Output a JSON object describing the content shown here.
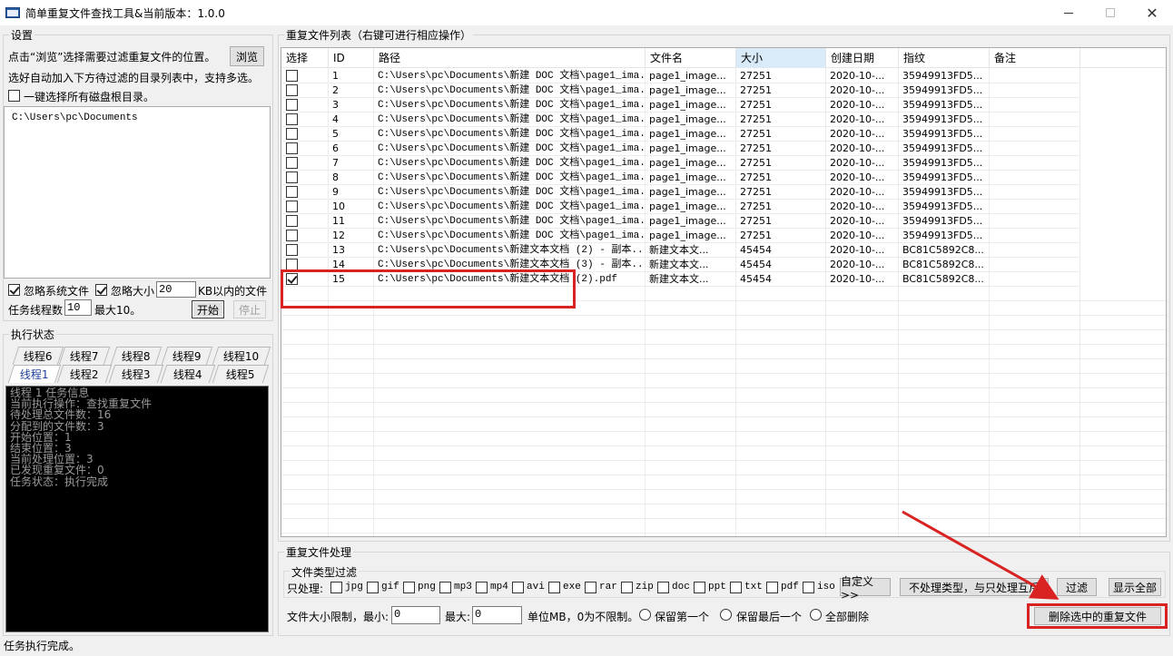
{
  "window": {
    "title": "简单重复文件查找工具&当前版本：1.0.0",
    "min_glyph": "—",
    "close_glyph": "✕"
  },
  "settings": {
    "group_label": "设置",
    "browse_hint": "点击“浏览”选择需要过滤重复文件的位置。",
    "browse_button": "浏览",
    "add_hint": "选好自动加入下方待过滤的目录列表中，支持多选。",
    "select_all_drives_label": "一键选择所有磁盘根目录。",
    "select_all_drives_checked": false,
    "directories": [
      "C:\\Users\\pc\\Documents"
    ],
    "ignore_system_label": "忽略系统文件",
    "ignore_system_checked": true,
    "ignore_size_label": "忽略大小",
    "ignore_size_checked": true,
    "ignore_size_value": "20",
    "ignore_size_unit": "KB以内的文件",
    "threads_label": "任务线程数",
    "threads_value": "10",
    "threads_max": "最大10。",
    "start_button": "开始",
    "stop_button": "停止"
  },
  "exec_status": {
    "group_label": "执行状态",
    "tabs_row1": [
      "线程6",
      "线程7",
      "线程8",
      "线程9",
      "线程10"
    ],
    "tabs_row2": [
      "线程1",
      "线程2",
      "线程3",
      "线程4",
      "线程5"
    ],
    "active_tab": "线程1",
    "console_lines": [
      "线程 1 任务信息",
      "当前执行操作：查找重复文件",
      "待处理总文件数：16",
      "分配到的文件数：3",
      "开始位置：1",
      "结束位置：3",
      "当前处理位置：3",
      "已发现重复文件：0",
      "任务状态：执行完成"
    ]
  },
  "file_list": {
    "group_label": "重复文件列表（右键可进行相应操作）",
    "columns": [
      "选择",
      "ID",
      "路径",
      "文件名",
      "大小",
      "创建日期",
      "指纹",
      "备注"
    ],
    "sorted_column": "大小",
    "rows": [
      {
        "checked": false,
        "id": "1",
        "path": "C:\\Users\\pc\\Documents\\新建 DOC 文档\\page1_ima...",
        "name": "page1_image...",
        "size": "27251",
        "date": "2020-10-...",
        "hash": "35949913FD5...",
        "note": ""
      },
      {
        "checked": false,
        "id": "2",
        "path": "C:\\Users\\pc\\Documents\\新建 DOC 文档\\page1_ima...",
        "name": "page1_image...",
        "size": "27251",
        "date": "2020-10-...",
        "hash": "35949913FD5...",
        "note": ""
      },
      {
        "checked": false,
        "id": "3",
        "path": "C:\\Users\\pc\\Documents\\新建 DOC 文档\\page1_ima...",
        "name": "page1_image...",
        "size": "27251",
        "date": "2020-10-...",
        "hash": "35949913FD5...",
        "note": ""
      },
      {
        "checked": false,
        "id": "4",
        "path": "C:\\Users\\pc\\Documents\\新建 DOC 文档\\page1_ima...",
        "name": "page1_image...",
        "size": "27251",
        "date": "2020-10-...",
        "hash": "35949913FD5...",
        "note": ""
      },
      {
        "checked": false,
        "id": "5",
        "path": "C:\\Users\\pc\\Documents\\新建 DOC 文档\\page1_ima...",
        "name": "page1_image...",
        "size": "27251",
        "date": "2020-10-...",
        "hash": "35949913FD5...",
        "note": ""
      },
      {
        "checked": false,
        "id": "6",
        "path": "C:\\Users\\pc\\Documents\\新建 DOC 文档\\page1_ima...",
        "name": "page1_image...",
        "size": "27251",
        "date": "2020-10-...",
        "hash": "35949913FD5...",
        "note": ""
      },
      {
        "checked": false,
        "id": "7",
        "path": "C:\\Users\\pc\\Documents\\新建 DOC 文档\\page1_ima...",
        "name": "page1_image...",
        "size": "27251",
        "date": "2020-10-...",
        "hash": "35949913FD5...",
        "note": ""
      },
      {
        "checked": false,
        "id": "8",
        "path": "C:\\Users\\pc\\Documents\\新建 DOC 文档\\page1_ima...",
        "name": "page1_image...",
        "size": "27251",
        "date": "2020-10-...",
        "hash": "35949913FD5...",
        "note": ""
      },
      {
        "checked": false,
        "id": "9",
        "path": "C:\\Users\\pc\\Documents\\新建 DOC 文档\\page1_ima...",
        "name": "page1_image...",
        "size": "27251",
        "date": "2020-10-...",
        "hash": "35949913FD5...",
        "note": ""
      },
      {
        "checked": false,
        "id": "10",
        "path": "C:\\Users\\pc\\Documents\\新建 DOC 文档\\page1_ima...",
        "name": "page1_image...",
        "size": "27251",
        "date": "2020-10-...",
        "hash": "35949913FD5...",
        "note": ""
      },
      {
        "checked": false,
        "id": "11",
        "path": "C:\\Users\\pc\\Documents\\新建 DOC 文档\\page1_ima...",
        "name": "page1_image...",
        "size": "27251",
        "date": "2020-10-...",
        "hash": "35949913FD5...",
        "note": ""
      },
      {
        "checked": false,
        "id": "12",
        "path": "C:\\Users\\pc\\Documents\\新建 DOC 文档\\page1_ima...",
        "name": "page1_image...",
        "size": "27251",
        "date": "2020-10-...",
        "hash": "35949913FD5...",
        "note": ""
      },
      {
        "checked": false,
        "id": "13",
        "path": "C:\\Users\\pc\\Documents\\新建文本文档 (2) - 副本...",
        "name": "新建文本文...",
        "size": "45454",
        "date": "2020-10-...",
        "hash": "BC81C5892C8...",
        "note": ""
      },
      {
        "checked": false,
        "id": "14",
        "path": "C:\\Users\\pc\\Documents\\新建文本文档 (3) - 副本...",
        "name": "新建文本文...",
        "size": "45454",
        "date": "2020-10-...",
        "hash": "BC81C5892C8...",
        "note": ""
      },
      {
        "checked": true,
        "id": "15",
        "path": "C:\\Users\\pc\\Documents\\新建文本文档 (2).pdf",
        "name": "新建文本文...",
        "size": "45454",
        "date": "2020-10-...",
        "hash": "BC81C5892C8...",
        "note": ""
      }
    ]
  },
  "processing": {
    "group_label": "重复文件处理",
    "filter_group_label": "文件类型过滤",
    "only_process_label": "只处理:",
    "types": [
      "jpg",
      "gif",
      "png",
      "mp3",
      "mp4",
      "avi",
      "exe",
      "rar",
      "zip",
      "doc",
      "ppt",
      "txt",
      "pdf",
      "iso"
    ],
    "custom_button": "自定义>>",
    "exclude_button": "不处理类型，与只处理互斥",
    "filter_button": "过滤",
    "show_all_button": "显示全部",
    "size_limit_label": "文件大小限制，最小:",
    "min_value": "0",
    "max_label": "最大:",
    "max_value": "0",
    "unit_hint": "单位MB，0为不限制。",
    "keep_first": "保留第一个",
    "keep_last": "保留最后一个",
    "delete_all": "全部删除",
    "delete_selected_button": "删除选中的重复文件"
  },
  "status_bar": {
    "text": "任务执行完成。"
  },
  "colors": {
    "highlight": "#d92222",
    "sorted_header": "#d9ebf9",
    "console_bg": "#000000"
  }
}
